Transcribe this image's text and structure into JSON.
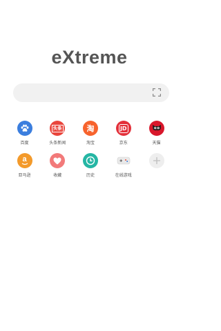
{
  "logo": {
    "text": "eXtreme"
  },
  "search": {
    "scan_icon": "scan-frame-icon"
  },
  "shortcuts": [
    {
      "label": "百度",
      "icon": "baidu-paw-icon",
      "color": "#3b7ede"
    },
    {
      "label": "头条新闻",
      "icon": "toutiao-icon",
      "color": "#e9453c",
      "glyph": "头条"
    },
    {
      "label": "淘宝",
      "icon": "taobao-icon",
      "color": "#f7632d",
      "glyph": "淘"
    },
    {
      "label": "京东",
      "icon": "jd-icon",
      "color": "#e3303a",
      "glyph": "JD"
    },
    {
      "label": "天猫",
      "icon": "tmall-cat-icon",
      "color": "#d8172b"
    },
    {
      "label": "亚马逊",
      "icon": "amazon-icon",
      "color": "#f39a2b",
      "glyph": "a"
    },
    {
      "label": "收藏",
      "icon": "heart-icon",
      "color": "#f27a7a"
    },
    {
      "label": "历史",
      "icon": "clock-icon",
      "color": "#25b6a4"
    },
    {
      "label": "在线游戏",
      "icon": "gamepad-icon",
      "color": "#e9e9e9"
    },
    {
      "label": "",
      "icon": "add-icon",
      "color": "#eeeeee"
    }
  ]
}
